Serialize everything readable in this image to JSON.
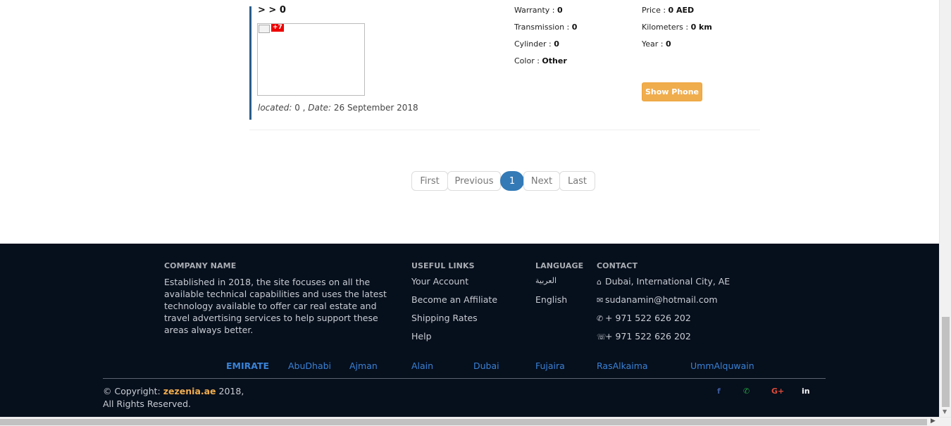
{
  "listing": {
    "title": "> > 0",
    "photo_count": "+7",
    "located_label": "located:",
    "located_value": "0 ,",
    "date_label": "Date:",
    "date_value": "26 September 2018",
    "specs_left": [
      {
        "label": "Warranty :",
        "value": "0"
      },
      {
        "label": "Transmission :",
        "value": "0"
      },
      {
        "label": "Cylinder :",
        "value": "0"
      },
      {
        "label": "Color :",
        "value": "Other"
      }
    ],
    "specs_right": [
      {
        "label": "Price :",
        "value": "0 AED"
      },
      {
        "label": "Kilometers :",
        "value": "0 km"
      },
      {
        "label": "Year :",
        "value": "0"
      }
    ],
    "show_phone_label": "Show Phone"
  },
  "pagination": {
    "first": "First",
    "previous": "Previous",
    "current": "1",
    "next": "Next",
    "last": "Last"
  },
  "footer": {
    "company": {
      "heading": "COMPANY NAME",
      "text": "Established in 2018, the site focuses on all the available technical capabilities and uses the latest technology available to offer car real estate and travel advertising services to help support these areas always better."
    },
    "useful_links": {
      "heading": "USEFUL LINKS",
      "items": [
        "Your Account",
        "Become an Affiliate",
        "Shipping Rates",
        "Help"
      ]
    },
    "language": {
      "heading": "LANGUAGE",
      "items": [
        "العربية",
        "English"
      ]
    },
    "contact": {
      "heading": "CONTACT",
      "address": "Dubai, International City, AE",
      "email": "sudanamin@hotmail.com",
      "phone": "+ 971 522 626 202",
      "whatsapp": "+ 971 522 626 202"
    },
    "emirates": {
      "heading": "EMIRATE",
      "items": [
        "AbuDhabi",
        "Ajman",
        "Alain",
        "Dubai",
        "Fujaira",
        "RasAlkaima",
        "UmmAlquwain"
      ]
    },
    "copyright": {
      "prefix": "© Copyright:",
      "brand": "zezenia.ae",
      "year": "2018,",
      "rights": "All Rights Reserved."
    },
    "social": [
      {
        "name": "facebook",
        "glyph": "f",
        "color": "#3b5998"
      },
      {
        "name": "whatsapp",
        "glyph": "✆",
        "color": "#25a244"
      },
      {
        "name": "google-plus",
        "glyph": "G+",
        "color": "#dd4b39"
      },
      {
        "name": "linkedin",
        "glyph": "in",
        "color": "#ffffff"
      }
    ]
  }
}
